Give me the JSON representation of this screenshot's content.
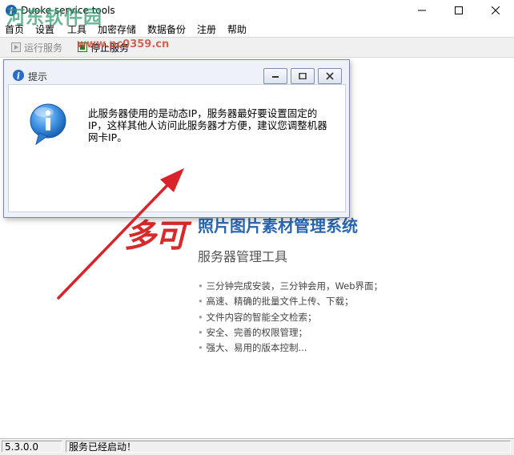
{
  "window": {
    "title": "Duoke service tools"
  },
  "watermark": {
    "text": "河东软件园",
    "url": "www.pc0359.cn"
  },
  "menu": {
    "items": [
      "首页",
      "设置",
      "工具",
      "加密存储",
      "数据备份",
      "注册",
      "帮助"
    ]
  },
  "toolbar": {
    "start_label": "运行服务",
    "stop_label": "停止服务"
  },
  "product": {
    "logo": "多可",
    "title": "照片图片素材管理系统",
    "subtitle": "服务器管理工具",
    "features": [
      "三分钟完成安装，三分钟会用，Web界面；",
      "高速、精确的批量文件上传、下载；",
      "文件内容的智能全文检索；",
      "安全、完善的权限管理；",
      "强大、易用的版本控制..."
    ]
  },
  "dialog": {
    "title": "提示",
    "message": "此服务器使用的是动态IP，服务器最好要设置固定的IP，这样其他人访问此服务器才方便，建议您调整机器网卡IP。"
  },
  "status": {
    "version": "5.3.0.0",
    "message": "服务已经启动！"
  },
  "colors": {
    "annotation_arrow": "#d9232a",
    "brand_blue": "#2a66b0",
    "brand_red": "#d72a2a"
  }
}
